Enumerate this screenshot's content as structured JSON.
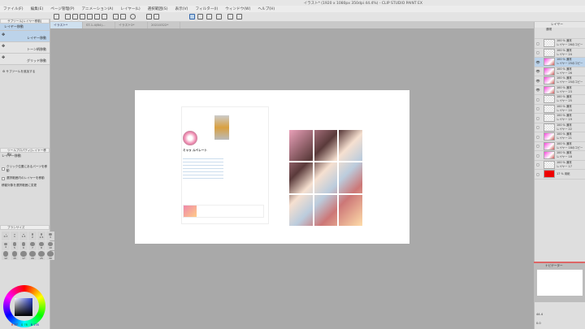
{
  "title": "イラスト* (1920 x 1080px 350dpi 44.4%) - CLIP STUDIO PAINT EX",
  "menu": [
    "ファイル(F)",
    "編集(E)",
    "ページ管理(P)",
    "アニメーション(A)",
    "レイヤー(L)",
    "選択範囲(S)",
    "表示(V)",
    "フィルター(I)",
    "ウィンドウ(W)",
    "ヘルプ(H)"
  ],
  "tabs": [
    "イラスト*",
    "ST-1-4(B4)...",
    "イラスト2*",
    "20210322*"
  ],
  "subtool": {
    "panel_title": "サブツール[レイヤー移動]",
    "group": "レイヤー移動",
    "items": [
      "レイヤー移動",
      "トーン柄移動",
      "グリッド移動"
    ],
    "add": "サブツールを追加する"
  },
  "toolprop": {
    "panel_title": "ツールプロパティ[レイヤー移動]",
    "name": "レイヤー移動",
    "options": [
      "クリック位置にあるパーツを移動",
      "選択範囲内のレイヤーを移動",
      "移動対象を選択範囲に変更"
    ]
  },
  "brushsize": {
    "panel_title": "ブラシサイズ",
    "sizes": [
      "0.7",
      "1",
      "1.5",
      "2",
      "2.5",
      "3",
      "4",
      "5",
      "6",
      "7",
      "8",
      "10",
      "12",
      "15",
      "17",
      "20",
      "25",
      "30"
    ]
  },
  "color": {
    "r": "R 37",
    "g": "G 78",
    "b": "B 178"
  },
  "layers": {
    "panel_title": "レイヤー",
    "blend": "通常",
    "items": [
      {
        "opacity": "100 % 通常",
        "name": "レイヤー 26のコピー",
        "visible": false,
        "img": false
      },
      {
        "opacity": "100 % 通常",
        "name": "レイヤー 24",
        "visible": false,
        "img": false
      },
      {
        "opacity": "100 % 通常",
        "name": "レイヤー 25のコピー",
        "visible": true,
        "img": true,
        "selected": true
      },
      {
        "opacity": "100 % 通常",
        "name": "レイヤー 26",
        "visible": true,
        "img": true
      },
      {
        "opacity": "100 % 通常",
        "name": "レイヤー 25のコピー",
        "visible": true,
        "img": true
      },
      {
        "opacity": "100 % 通常",
        "name": "レイヤー 23",
        "visible": true,
        "img": true
      },
      {
        "opacity": "100 % 通常",
        "name": "レイヤー 25",
        "visible": false,
        "img": false
      },
      {
        "opacity": "100 % 通常",
        "name": "レイヤー 20",
        "visible": false,
        "img": false
      },
      {
        "opacity": "100 % 通常",
        "name": "レイヤー 19",
        "visible": false,
        "img": false
      },
      {
        "opacity": "100 % 通常",
        "name": "レイヤー 22",
        "visible": false,
        "img": false
      },
      {
        "opacity": "100 % 通常",
        "name": "レイヤー 21",
        "visible": false,
        "img": true
      },
      {
        "opacity": "100 % 通常",
        "name": "レイヤー 18のコピー",
        "visible": false,
        "img": true
      },
      {
        "opacity": "100 % 通常",
        "name": "レイヤー 18",
        "visible": false,
        "img": true
      },
      {
        "opacity": "100 % 通常",
        "name": "レイヤー 17",
        "visible": false,
        "img": false
      },
      {
        "opacity": "17 % 用紙",
        "name": "",
        "visible": false,
        "img": false
      }
    ]
  },
  "navigator": {
    "panel_title": "ナビゲーター",
    "zoom": "44.4",
    "angle": "0.0"
  },
  "canvas_content": {
    "profile_name": "ミャゥ ルベレート"
  }
}
